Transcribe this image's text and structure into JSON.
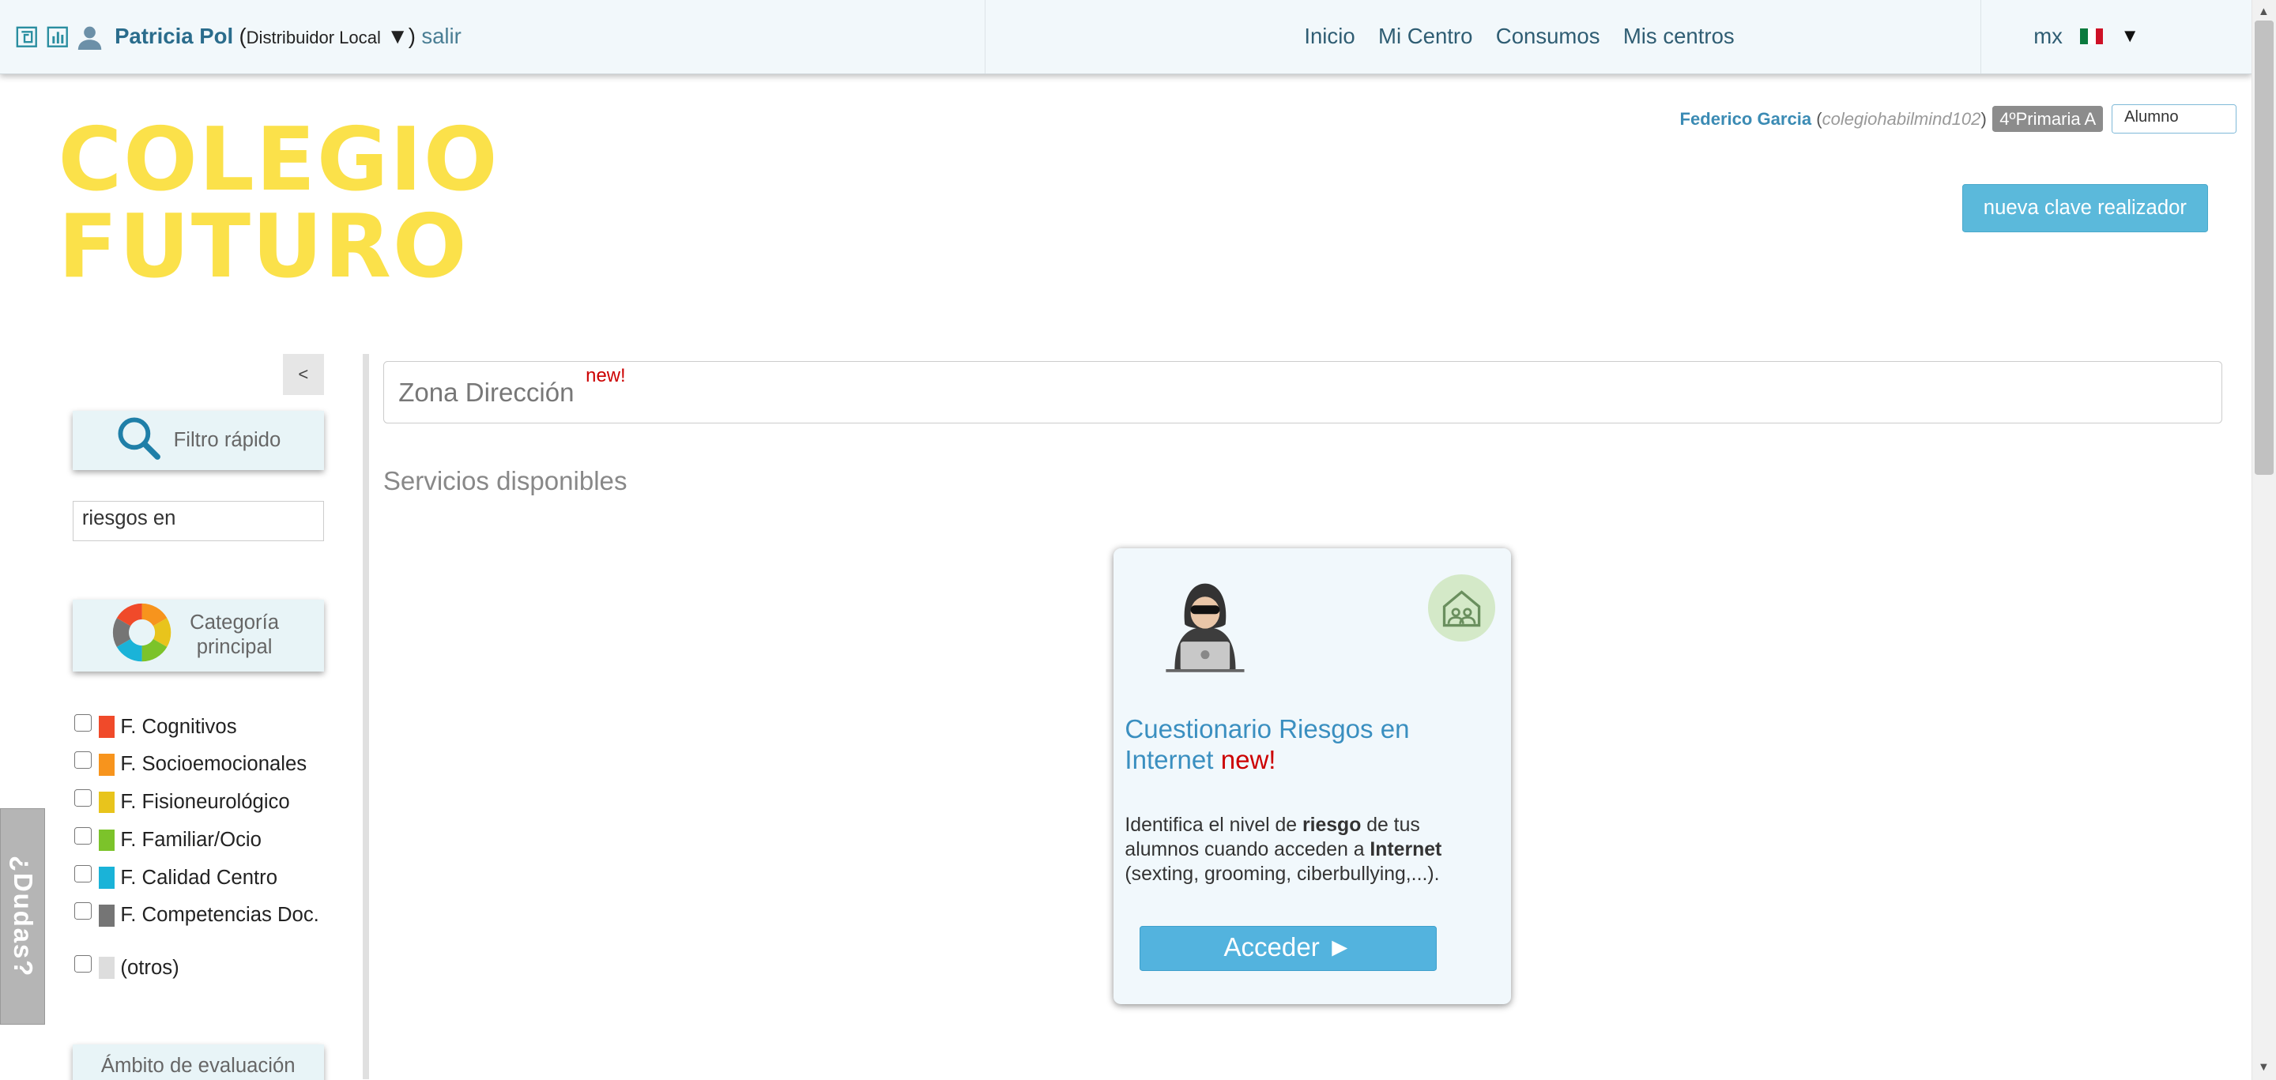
{
  "topbar": {
    "user_name": "Patricia Pol",
    "role_open": "(",
    "role": "Distribuidor Local",
    "role_close": "▼)",
    "logout": "salir",
    "nav": [
      "Inicio",
      "Mi Centro",
      "Consumos",
      "Mis centros"
    ],
    "lang": "mx",
    "caret": "▼",
    "icons": [
      "logo-icon",
      "chart-icon",
      "user-icon",
      "mexico-flag-icon"
    ]
  },
  "logo": {
    "line1": "COLEGIO",
    "line2": "FUTURO",
    "color": "#fbe14a"
  },
  "student": {
    "name": "Federico Garcia",
    "login": "colegiohabilmind102",
    "grade": "4ºPrimaria A",
    "role_value": "Alumno"
  },
  "new_key_button": "nueva clave realizador",
  "sidebar": {
    "collapse": "<",
    "quick_filter": "Filtro rápido",
    "search_value": "riesgos en",
    "category": "Categoría principal",
    "filters": [
      {
        "label": "F. Cognitivos",
        "color": "#f04a2a"
      },
      {
        "label": "F. Socioemocionales",
        "color": "#f7941d"
      },
      {
        "label": "F. Fisioneurológico",
        "color": "#e8c41c"
      },
      {
        "label": "F. Familiar/Ocio",
        "color": "#7cc32a"
      },
      {
        "label": "F. Calidad Centro",
        "color": "#1ab3d8"
      },
      {
        "label": "F. Competencias Doc.",
        "color": "#757575"
      }
    ],
    "others": {
      "label": "(otros)",
      "color": "#dddddd"
    },
    "scope": "Ámbito de evaluación",
    "help_tab": "¿Dudas?"
  },
  "main": {
    "zone_title": "Zona Dirección",
    "zone_new": "new!",
    "services_title": "Servicios disponibles",
    "card": {
      "title": "Cuestionario Riesgos en Internet",
      "title_new": "new!",
      "desc_1": "Identifica el nivel de ",
      "desc_b1": "riesgo",
      "desc_2": " de tus alumnos cuando acceden a ",
      "desc_b2": "Internet",
      "desc_3": " (sexting, grooming, ciberbullying,...).",
      "button": "Acceder ►",
      "icons": [
        "hacker-icon",
        "home-icon"
      ]
    }
  }
}
